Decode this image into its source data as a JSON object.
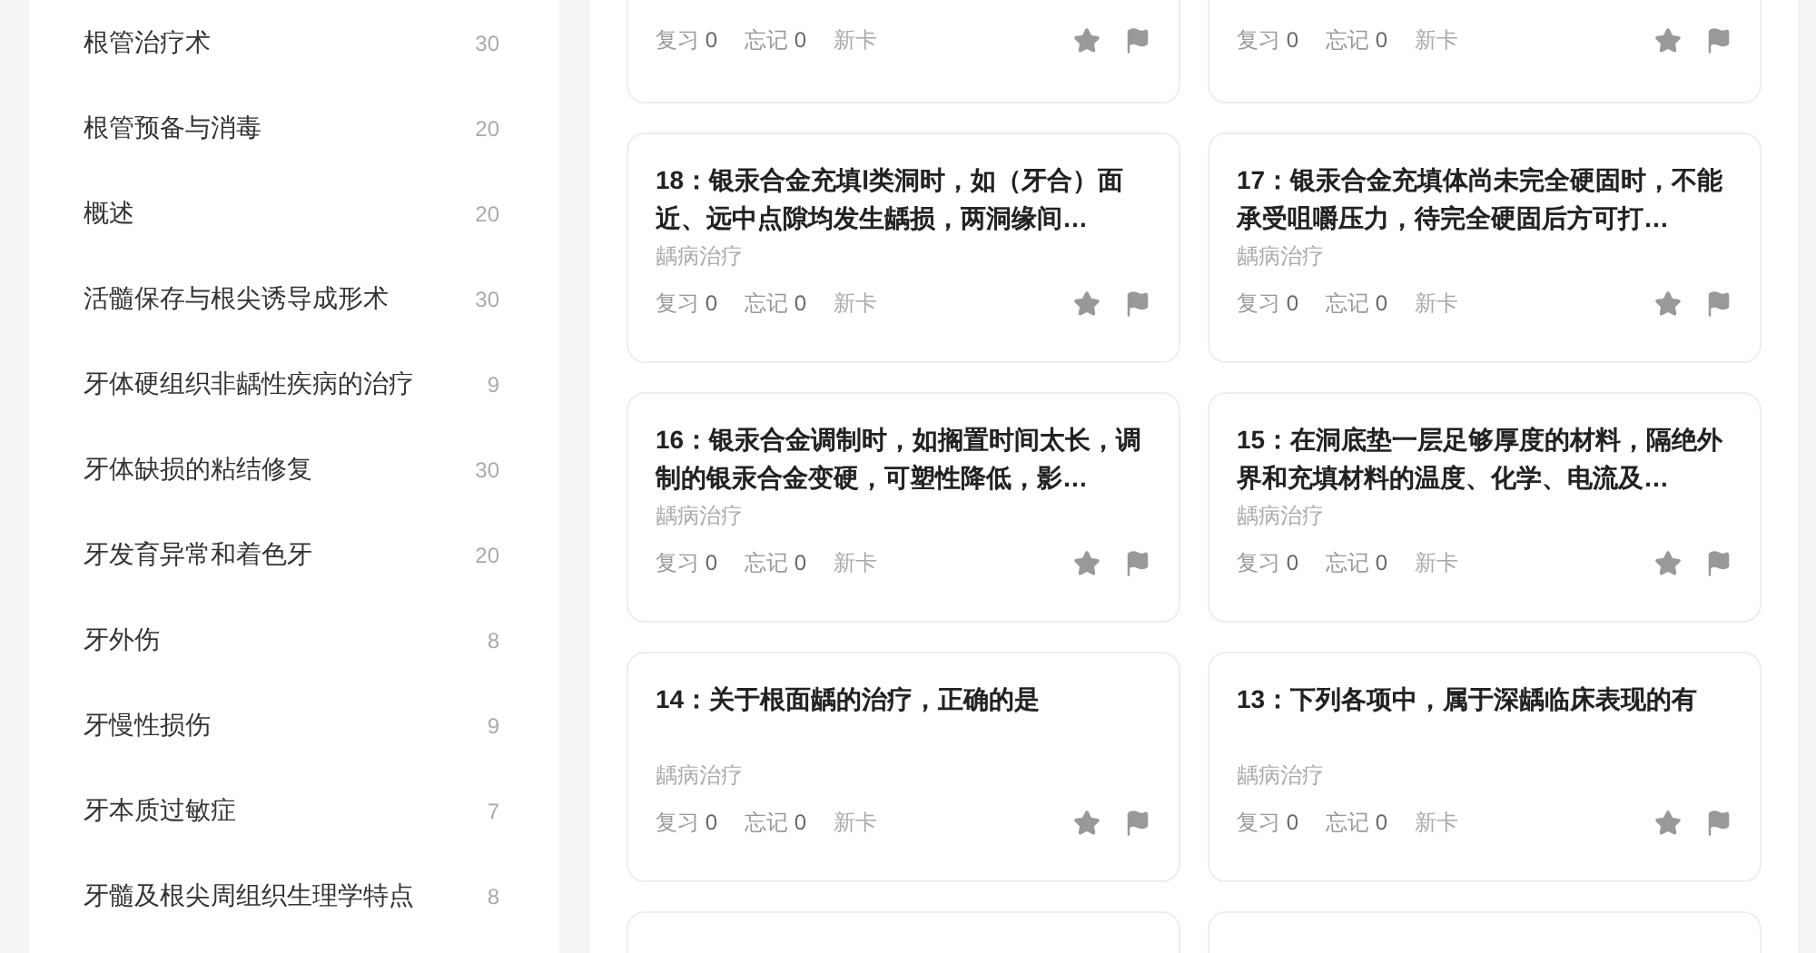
{
  "sidebar": {
    "items": [
      {
        "label": "根管治疗术",
        "count": "30"
      },
      {
        "label": "根管预备与消毒",
        "count": "20"
      },
      {
        "label": "概述",
        "count": "20"
      },
      {
        "label": "活髓保存与根尖诱导成形术",
        "count": "30"
      },
      {
        "label": "牙体硬组织非龋性疾病的治疗",
        "count": "9"
      },
      {
        "label": "牙体缺损的粘结修复",
        "count": "30"
      },
      {
        "label": "牙发育异常和着色牙",
        "count": "20"
      },
      {
        "label": "牙外伤",
        "count": "8"
      },
      {
        "label": "牙慢性损伤",
        "count": "9"
      },
      {
        "label": "牙本质过敏症",
        "count": "7"
      },
      {
        "label": "牙髓及根尖周组织生理学特点",
        "count": "8"
      }
    ]
  },
  "cards": [
    {
      "kind": "partial",
      "review_label": "复习",
      "review_count": "0",
      "forget_label": "忘记",
      "forget_count": "0",
      "new_label": "新卡"
    },
    {
      "kind": "partial",
      "review_label": "复习",
      "review_count": "0",
      "forget_label": "忘记",
      "forget_count": "0",
      "new_label": "新卡"
    },
    {
      "kind": "full",
      "title": "18：银汞合金充填Ⅰ类洞时，如（牙合）面近、远中点隙均发生龋损，两洞缘间…",
      "category": "龋病治疗",
      "review_label": "复习",
      "review_count": "0",
      "forget_label": "忘记",
      "forget_count": "0",
      "new_label": "新卡"
    },
    {
      "kind": "full",
      "title": "17：银汞合金充填体尚未完全硬固时，不能承受咀嚼压力，待完全硬固后方可打…",
      "category": "龋病治疗",
      "review_label": "复习",
      "review_count": "0",
      "forget_label": "忘记",
      "forget_count": "0",
      "new_label": "新卡"
    },
    {
      "kind": "full",
      "title": "16：银汞合金调制时，如搁置时间太长，调制的银汞合金变硬，可塑性降低，影…",
      "category": "龋病治疗",
      "review_label": "复习",
      "review_count": "0",
      "forget_label": "忘记",
      "forget_count": "0",
      "new_label": "新卡"
    },
    {
      "kind": "full",
      "title": "15：在洞底垫一层足够厚度的材料，隔绝外界和充填材料的温度、化学、电流及…",
      "category": "龋病治疗",
      "review_label": "复习",
      "review_count": "0",
      "forget_label": "忘记",
      "forget_count": "0",
      "new_label": "新卡"
    },
    {
      "kind": "full",
      "title": "14：关于根面龋的治疗，正确的是",
      "category": "龋病治疗",
      "review_label": "复习",
      "review_count": "0",
      "forget_label": "忘记",
      "forget_count": "0",
      "new_label": "新卡"
    },
    {
      "kind": "full",
      "title": "13：下列各项中，属于深龋临床表现的有",
      "category": "龋病治疗",
      "review_label": "复习",
      "review_count": "0",
      "forget_label": "忘记",
      "forget_count": "0",
      "new_label": "新卡"
    }
  ]
}
